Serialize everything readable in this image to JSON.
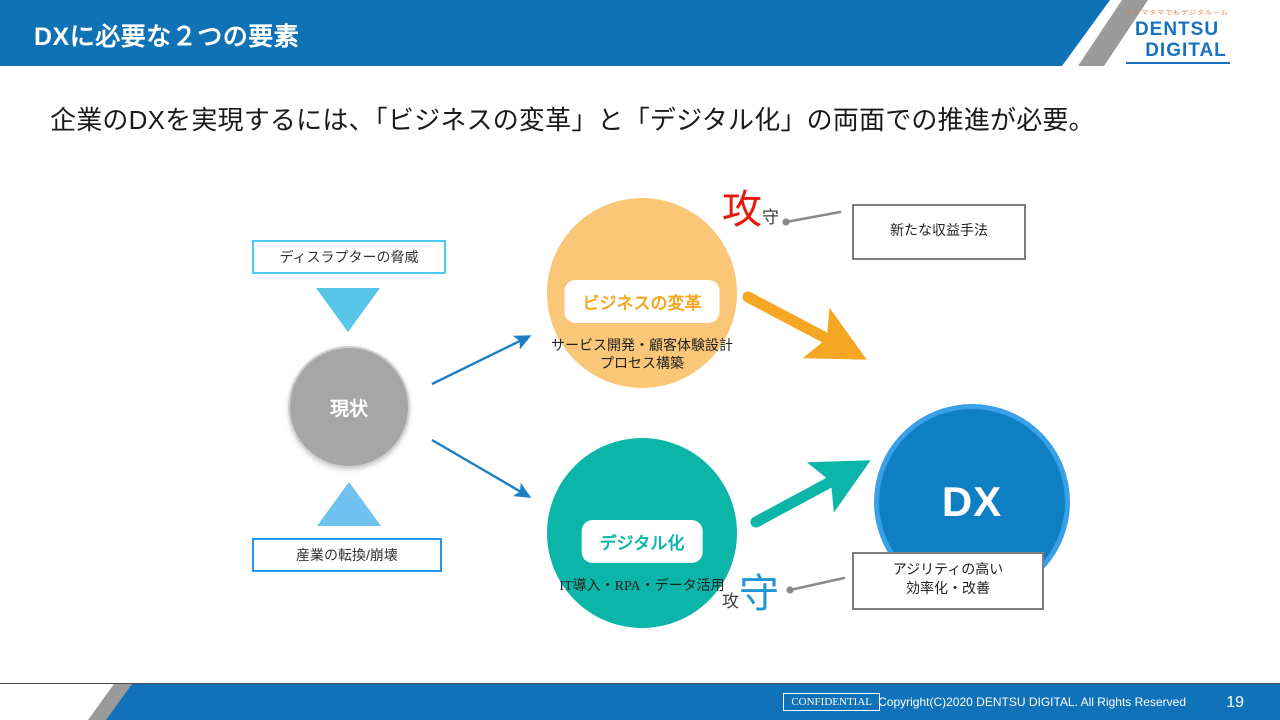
{
  "header": {
    "title": "DXに必要な２つの要素",
    "bar_color": "#0f72b5",
    "stripe_color": "#9a9a9a"
  },
  "logo": {
    "kana": "ツラマタマでもデジタルーム",
    "line1": "DENTSU",
    "line2": "DIGITAL",
    "kana_color": "#e8743b",
    "text_color": "#1772c0"
  },
  "lead": {
    "text": "企業のDXを実現するには、「ビジネスの変革」と「デジタル化」の両面での推進が必要。"
  },
  "diagram": {
    "left_column": {
      "top_tag": {
        "label": "ディスラプターの脅威",
        "border_color": "#4ecbec"
      },
      "down_triangle": {
        "name": "down-triangle",
        "color": "#57c6e8"
      },
      "center_circle": {
        "label": "現状",
        "color": "#a6a6a6"
      },
      "up_triangle": {
        "name": "up-triangle",
        "color": "#6ec1f0"
      },
      "bottom_tag": {
        "label": "産業の転換/崩壊",
        "border_color": "#2196f3"
      }
    },
    "business": {
      "pill_label": "ビジネスの変革",
      "caption_line1": "サービス開発・顧客体験設計",
      "caption_line2": "プロセス構築",
      "circle_color": "#f9c777",
      "accent_color": "#f5a623"
    },
    "digital": {
      "pill_label": "デジタル化",
      "caption_line1": "IT導入・RPA・データ活用",
      "caption_line2": "",
      "circle_color": "#0bb5a8",
      "accent_color": "#0bb5a8"
    },
    "dx": {
      "label": "DX",
      "circle_color": "#0f7fc4",
      "ring_color": "#3aa0e8"
    },
    "annotations": {
      "top": {
        "big": "攻",
        "small": "守",
        "big_color": "#e8180c"
      },
      "bottom": {
        "small": "攻",
        "big": "守",
        "big_color": "#2196d6"
      }
    },
    "callouts": {
      "revenue": {
        "line1": "新たな収益手法",
        "line2": ""
      },
      "agility": {
        "line1": "アジリティの高い",
        "line2": "効率化・改善"
      }
    },
    "arrows": {
      "branch_color": "#1a7fc4",
      "business_arrow_color": "#f5a623",
      "digital_arrow_color": "#0bb5a8",
      "leader_color": "#8a8a8a"
    }
  },
  "footer": {
    "confidential": "CONFIDENTIAL",
    "copyright": "Copyright(C)2020 DENTSU DIGITAL. All Rights Reserved",
    "page": "19",
    "bar_color": "#1072b8"
  }
}
